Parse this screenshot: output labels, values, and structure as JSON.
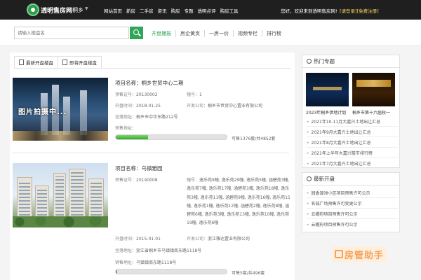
{
  "header": {
    "brand": "透明售房网",
    "city": "桐乡",
    "nav": [
      "网站首页",
      "新房",
      "二手房",
      "资讯",
      "购房",
      "专题",
      "透明点评",
      "购房工具"
    ],
    "welcome": "您好，欢迎来到透明售房网!",
    "login_links": "[请登录][免费注册]"
  },
  "search": {
    "placeholder": "请输入楼盘名",
    "nav": [
      "开盘播报",
      "房企黄页",
      "一房一价",
      "视频专栏",
      "排行榜"
    ]
  },
  "tabs": [
    "最新开盘楼盘",
    "即将开盘楼盘"
  ],
  "listings": [
    {
      "thumb_label": "图片拍摄中...",
      "name_label": "项目名称：",
      "name": "桐乡世贸中心二期",
      "permit_label": "预售证号：",
      "permit": "20130002",
      "building_label": "幢号：",
      "building": "1",
      "open_label": "开盘时间：",
      "open_date": "2018-01-25",
      "developer_label": "开发公司：",
      "developer": "桐乡市世贸中心置业有限公司",
      "address_label": "坐落地址：",
      "address": "桐乡市中华东路212号",
      "sales_label": "销售地址：",
      "sales_address": "",
      "progress": 0.29,
      "progress_text": "可售1376套/共4852套"
    },
    {
      "name_label": "项目名称：",
      "name": "乌镇雅园",
      "permit_label": "预售证号：",
      "permit": "20140008",
      "building_label": "幢号：",
      "building": "逸乐苑9幢, 逸乐苑29幢, 逸乐苑5幢, 涵碧苑3幢, 逸乐苑7幢, 逸乐苑17幢, 涵碧苑1幢, 逸乐苑18幢, 逸乐苑3幢, 逸乐苑11幢, 涵碧苑9幢, 逸乐苑16幢, 逸乐苑15幢, 逸乐苑1幢, 逸乐苑12幢, 涵碧苑2幢, 逸乐苑8幢, 涵碧苑6幢, 逸乐苑3幢, 逸乐苑13幢, 逸乐苑10幢, 逸乐苑19幢, 逸乐苑6幢",
      "open_label": "开盘时间：",
      "open_date": "2015-01-01",
      "developer_label": "开发公司：",
      "developer": "浙江雅达置业有限公司",
      "address_label": "坐落地址：",
      "address": "浙江省桐乡市乌镇镇南东路1118号",
      "sales_label": "销售地址：",
      "sales_address": "乌镇镇南东路1118号",
      "progress": 0.01,
      "progress_text": "可售5套/共496套"
    }
  ],
  "sidebar": {
    "hot_title": "热门专题",
    "promos": [
      "2023年桐乡供地计划",
      "桐乡市第十六届秋一"
    ],
    "hot_items": [
      "2021年10-11月大嘉兴土地出让汇总",
      "2021年9月大嘉兴土地出让汇总",
      "2021年8月大嘉兴土地出让汇总",
      "2021年上半年大嘉兴楼市排行榜",
      "2021年7月大嘉兴土地出让汇总"
    ],
    "new_title": "最新开盘",
    "new_items": [
      "园香源洲小区项目预售许可公示",
      "名城广场预售许可变更公示",
      "云樾府项目预售许可公示",
      "云樾府项目预售许可公示"
    ]
  },
  "watermark": "房管助手",
  "colors": {
    "accent": "#32a55a",
    "topbar": "#1f1f1f",
    "login": "#f7d25c"
  }
}
